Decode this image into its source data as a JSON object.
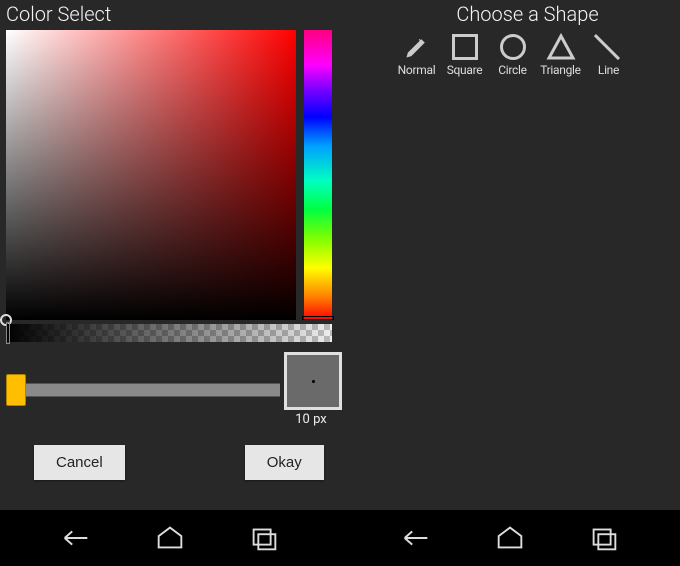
{
  "left": {
    "title": "Color Select",
    "size_label": "10 px",
    "buttons": {
      "cancel": "Cancel",
      "okay": "Okay"
    }
  },
  "right": {
    "title": "Choose a Shape",
    "shapes": {
      "normal": "Normal",
      "square": "Square",
      "circle": "Circle",
      "triangle": "Triangle",
      "line": "Line"
    }
  }
}
